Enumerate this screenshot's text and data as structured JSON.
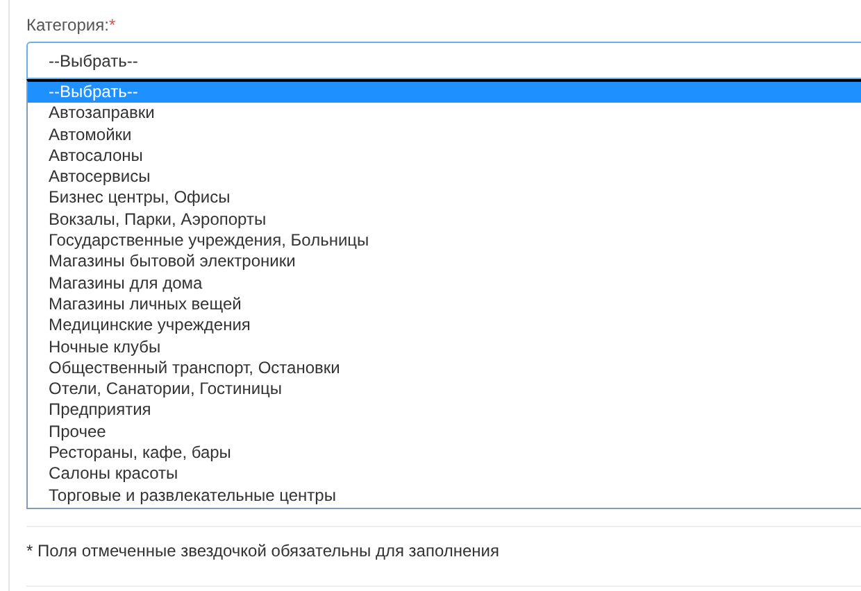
{
  "field": {
    "label": "Категория:",
    "required_mark": "*",
    "value": "--Выбрать--"
  },
  "options": [
    {
      "label": "--Выбрать--",
      "selected": true
    },
    {
      "label": "Автозаправки",
      "selected": false
    },
    {
      "label": "Автомойки",
      "selected": false
    },
    {
      "label": "Автосалоны",
      "selected": false
    },
    {
      "label": "Автосервисы",
      "selected": false
    },
    {
      "label": "Бизнес центры, Офисы",
      "selected": false
    },
    {
      "label": "Вокзалы, Парки, Аэропорты",
      "selected": false
    },
    {
      "label": "Государственные учреждения, Больницы",
      "selected": false
    },
    {
      "label": "Магазины бытовой электроники",
      "selected": false
    },
    {
      "label": "Магазины для дома",
      "selected": false
    },
    {
      "label": "Магазины личных вещей",
      "selected": false
    },
    {
      "label": "Медицинские учреждения",
      "selected": false
    },
    {
      "label": "Ночные клубы",
      "selected": false
    },
    {
      "label": "Общественный транспорт, Остановки",
      "selected": false
    },
    {
      "label": "Отели, Санатории, Гостиницы",
      "selected": false
    },
    {
      "label": "Предприятия",
      "selected": false
    },
    {
      "label": "Прочее",
      "selected": false
    },
    {
      "label": "Рестораны, кафе, бары",
      "selected": false
    },
    {
      "label": "Салоны красоты",
      "selected": false
    },
    {
      "label": "Торговые и развлекательные центры",
      "selected": false
    }
  ],
  "note": "* Поля отмеченные звездочкой обязательны для заполнения"
}
